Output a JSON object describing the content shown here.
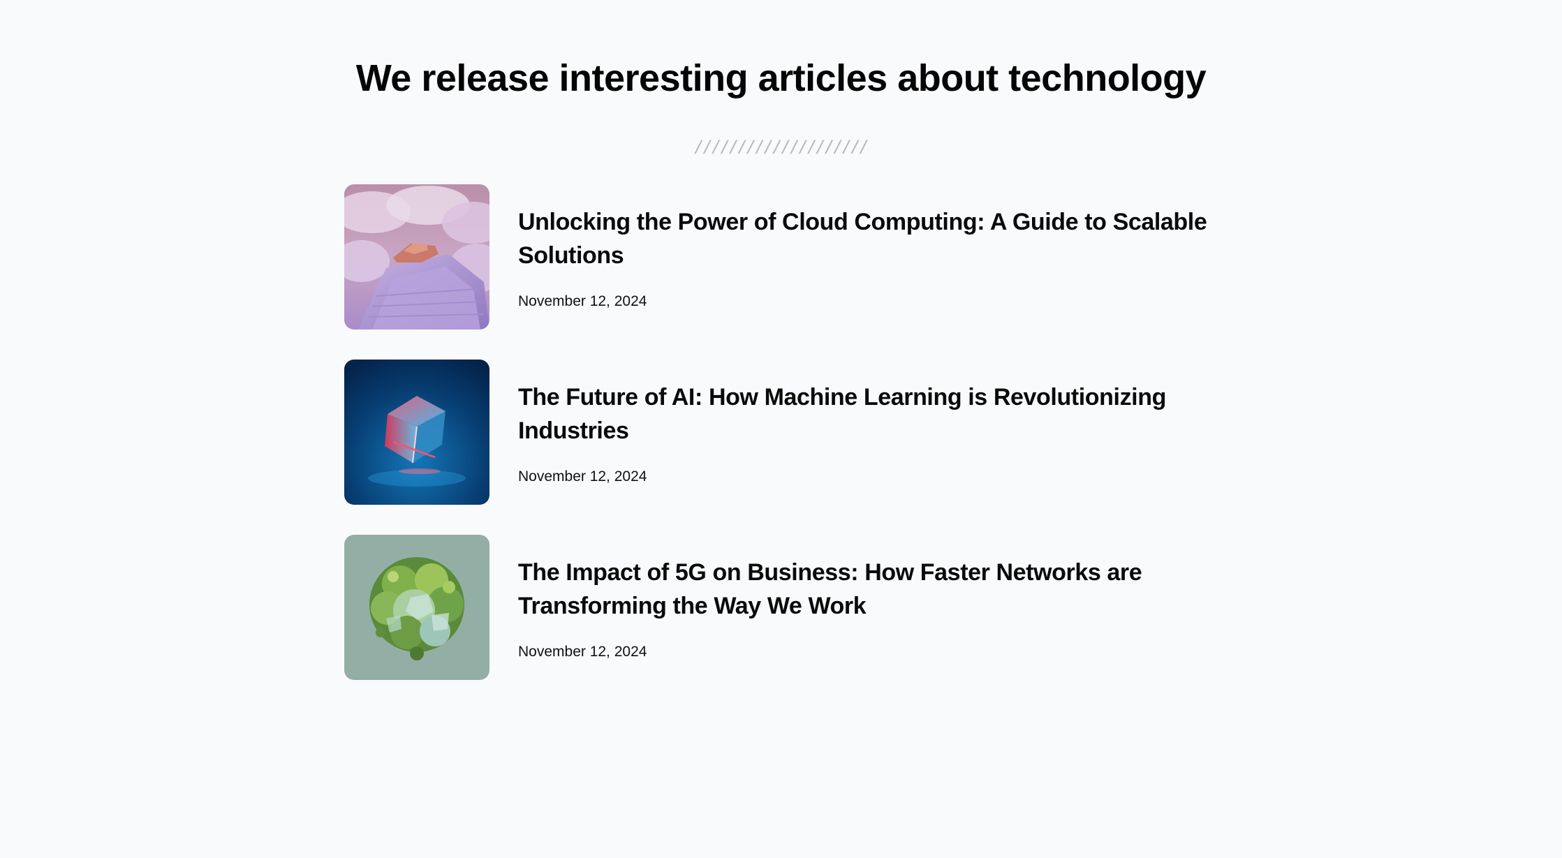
{
  "section": {
    "heading": "We release interesting articles about technology",
    "divider": "////////////////////"
  },
  "articles": [
    {
      "title": "Unlocking the Power of Cloud Computing: A Guide to Scalable Solutions",
      "date": "November 12, 2024",
      "image_icon": "cloud-steps-image"
    },
    {
      "title": "The Future of AI: How Machine Learning is Revolutionizing Industries",
      "date": "November 12, 2024",
      "image_icon": "glass-cube-image"
    },
    {
      "title": "The Impact of 5G on Business: How Faster Networks are Transforming the Way We Work",
      "date": "November 12, 2024",
      "image_icon": "green-foliage-sphere-image"
    }
  ],
  "colors": {
    "background": "#f9fafb",
    "text": "#0a0a0a",
    "divider": "#b8b8b8"
  }
}
